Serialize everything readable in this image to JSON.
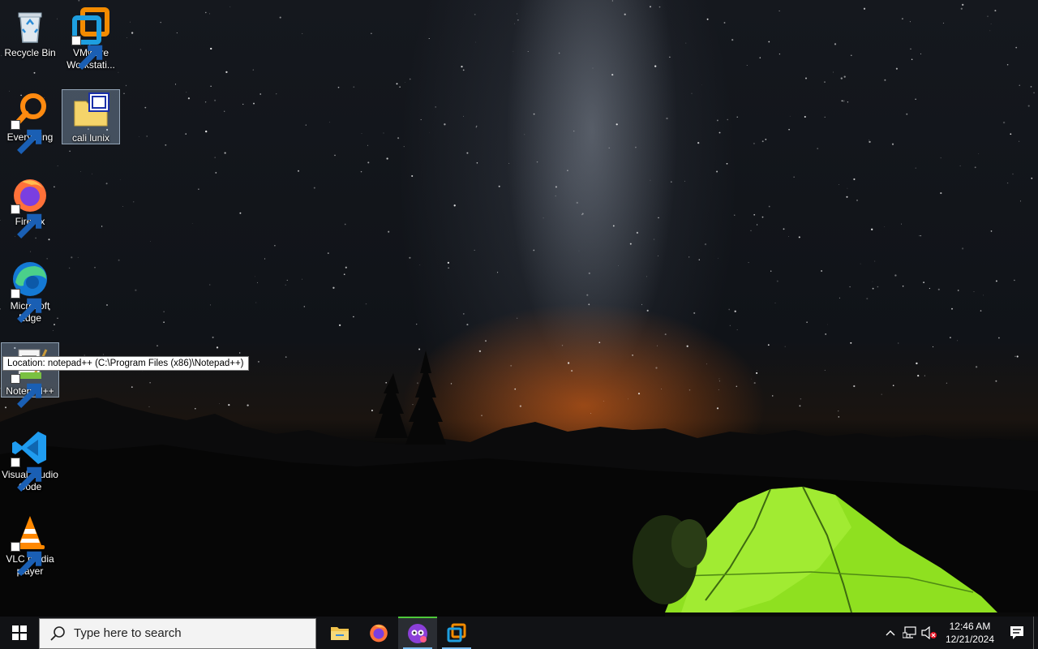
{
  "desktop": {
    "icons": [
      {
        "id": "recycle-bin",
        "label": "Recycle Bin"
      },
      {
        "id": "vmware",
        "label": "VMware Workstati..."
      },
      {
        "id": "everything",
        "label": "Everything"
      },
      {
        "id": "cali-lunix",
        "label": "cali lunix"
      },
      {
        "id": "firefox",
        "label": "Firefox"
      },
      {
        "id": "edge",
        "label": "Microsoft Edge"
      },
      {
        "id": "notepadpp",
        "label": "Notepad++"
      },
      {
        "id": "vscode",
        "label": "Visual Studio Code"
      },
      {
        "id": "vlc",
        "label": "VLC media player"
      }
    ],
    "tooltip": "Location: notepad++ (C:\\Program Files (x86)\\Notepad++)"
  },
  "taskbar": {
    "search_placeholder": "Type here to search",
    "pinned": [
      "file-explorer-icon",
      "firefox-icon",
      "ai-app-icon",
      "vmware-icon"
    ],
    "clock_time": "12:46 AM",
    "clock_date": "12/21/2024"
  },
  "colors": {
    "taskbar_bg": "#111215",
    "accent": "#76b9ed",
    "tent_green": "#8fe020",
    "horizon_glow": "#ff6e14"
  }
}
